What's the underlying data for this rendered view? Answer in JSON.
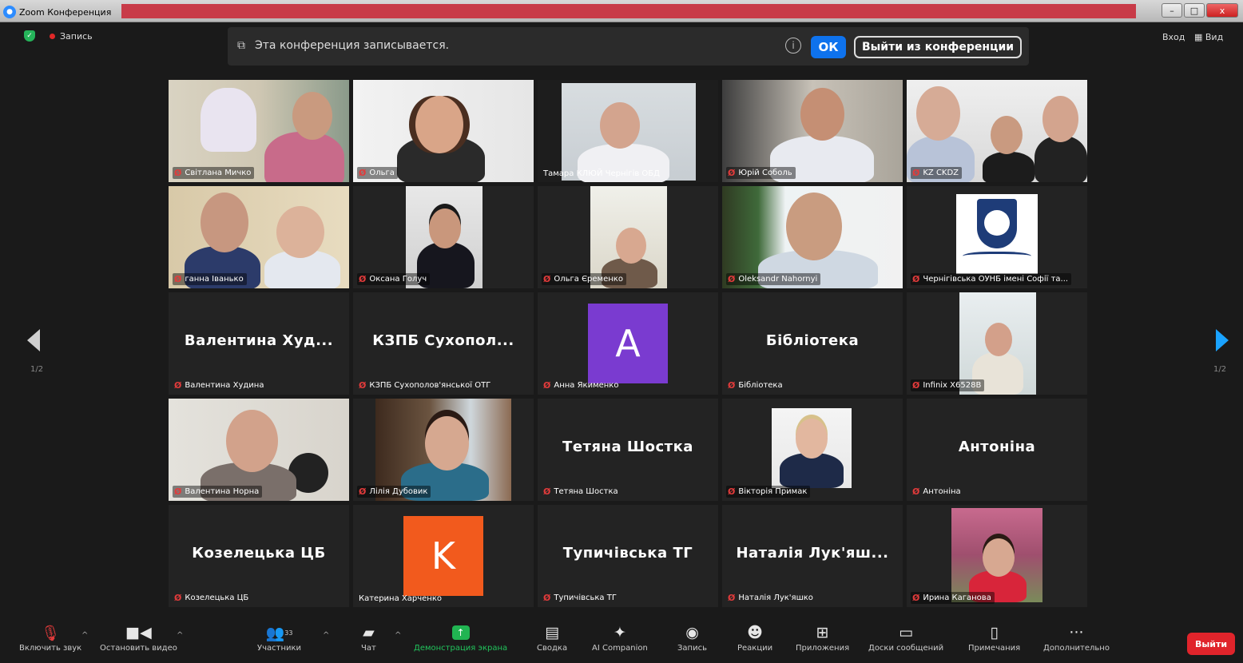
{
  "window": {
    "title": "Zoom Конференция",
    "minimize": "–",
    "maximize": "□",
    "close": "x"
  },
  "topbar": {
    "recording_indicator": "Запись",
    "banner_text": "Эта конференция записывается.",
    "info": "i",
    "ok_label": "ОК",
    "leave_label": "Выйти из конференции",
    "signin": "Вход",
    "view": "Вид"
  },
  "pagination": {
    "left": "1/2",
    "right": "1/2"
  },
  "tiles": [
    {
      "label": "Світлана Мичко",
      "muted": true,
      "type": "video"
    },
    {
      "label": "Ольга",
      "muted": true,
      "type": "video"
    },
    {
      "label": "Тамара КЛЮЙ Чернігів ОБД",
      "muted": false,
      "type": "video",
      "speaking": true
    },
    {
      "label": "Юрій Соболь",
      "muted": true,
      "type": "video"
    },
    {
      "label": "KZ CKDZ",
      "muted": true,
      "type": "video"
    },
    {
      "label": "ганна Іванько",
      "muted": true,
      "type": "video"
    },
    {
      "label": "Оксана Голуч",
      "muted": true,
      "type": "video"
    },
    {
      "label": "Ольга Єременко",
      "muted": true,
      "type": "video"
    },
    {
      "label": "Oleksandr Nahornyi",
      "muted": true,
      "type": "video"
    },
    {
      "label": "Чернігівська ОУНБ імені Софії та...",
      "muted": true,
      "type": "logo"
    },
    {
      "label": "Валентина Худина",
      "muted": true,
      "type": "name",
      "display": "Валентина  Худ..."
    },
    {
      "label": "КЗПБ Сухополов'янської ОТГ",
      "muted": true,
      "type": "name",
      "display": "КЗПБ Сухопол..."
    },
    {
      "label": "Анна Якименко",
      "muted": true,
      "type": "avatar",
      "letter": "A",
      "color": "#7a3bd0"
    },
    {
      "label": "Бібліотека",
      "muted": true,
      "type": "name",
      "display": "Бібліотека"
    },
    {
      "label": "Infinix X6528B",
      "muted": true,
      "type": "photo"
    },
    {
      "label": "Валентина Норна",
      "muted": true,
      "type": "video"
    },
    {
      "label": "Лілія Дубовик",
      "muted": true,
      "type": "video"
    },
    {
      "label": "Тетяна Шостка",
      "muted": true,
      "type": "name",
      "display": "Тетяна Шостка"
    },
    {
      "label": "Вікторія Примак",
      "muted": true,
      "type": "photo"
    },
    {
      "label": "Антоніна",
      "muted": true,
      "type": "name",
      "display": "Антоніна"
    },
    {
      "label": "Козелецька ЦБ",
      "muted": true,
      "type": "name",
      "display": "Козелецька ЦБ"
    },
    {
      "label": "Катерина Харченко",
      "muted": false,
      "type": "avatar",
      "letter": "K",
      "color": "#f25a1d"
    },
    {
      "label": "Тупичівська ТГ",
      "muted": true,
      "type": "name",
      "display": "Тупичівська ТГ"
    },
    {
      "label": "Наталія Лук'яшко",
      "muted": true,
      "type": "name",
      "display": "Наталія  Лук'яш..."
    },
    {
      "label": "Ирина Каганова",
      "muted": true,
      "type": "photo"
    }
  ],
  "toolbar": {
    "audio": "Включить звук",
    "video": "Остановить видео",
    "participants": "Участники",
    "participants_count": "33",
    "chat": "Чат",
    "share": "Демонстрация экрана",
    "summary": "Сводка",
    "ai": "AI Companion",
    "record": "Запись",
    "reactions": "Реакции",
    "apps": "Приложения",
    "whiteboards": "Доски сообщений",
    "notes": "Примечания",
    "more": "Дополнительно",
    "leave": "Выйти"
  }
}
